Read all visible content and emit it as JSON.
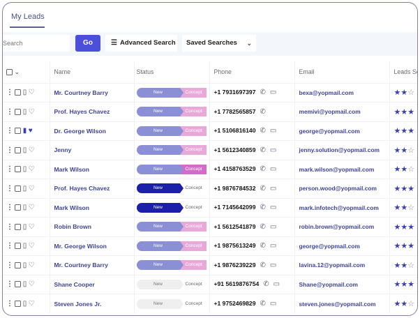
{
  "tabs": [
    {
      "label": "My Leads",
      "active": true
    }
  ],
  "toolbar": {
    "search_placeholder": "Search",
    "go_label": "Go",
    "advanced_label": "Advanced Search",
    "saved_label": "Saved Searches"
  },
  "columns": [
    "Name",
    "Status",
    "Phone",
    "Email",
    "Leads Sc"
  ],
  "colors": {
    "accent": "#4c4fd8",
    "status_light": "#8b8fd6",
    "status_dark": "#1c1fa8",
    "concept_pink": "#e8a8d8",
    "concept_magenta": "#d36cc6",
    "neutral": "#efefef"
  },
  "rows": [
    {
      "name": "Mr. Courtney Barry",
      "status": "New",
      "stage": "Concept",
      "style": "light",
      "concept": "pink",
      "phone": "+1 7931697397",
      "msg": true,
      "email": "bexa@yopmail.com",
      "stars": 2,
      "bookmarked": false,
      "liked": false
    },
    {
      "name": "Prof. Hayes Chavez",
      "status": "New",
      "stage": "Concept",
      "style": "light",
      "concept": "pink",
      "phone": "+1 7782565857",
      "msg": false,
      "email": "memivi@yopmail.com",
      "stars": 3,
      "bookmarked": false,
      "liked": false
    },
    {
      "name": "Dr. George Wilson",
      "status": "New",
      "stage": "Concept",
      "style": "light",
      "concept": "pink",
      "phone": "+1 5106816140",
      "msg": true,
      "email": "george@yopmail.com",
      "stars": 3,
      "bookmarked": true,
      "liked": true
    },
    {
      "name": "Jenny",
      "status": "New",
      "stage": "Concept",
      "style": "light",
      "concept": "pink",
      "phone": "+1 5612340859",
      "msg": true,
      "email": "jenny.solution@yopmail.com",
      "stars": 2,
      "bookmarked": false,
      "liked": false
    },
    {
      "name": "Mark Wilson",
      "status": "New",
      "stage": "Concept",
      "style": "light",
      "concept": "magenta",
      "phone": "+1 4158763529",
      "msg": true,
      "email": "mark.wilson@yopmail.com",
      "stars": 2,
      "bookmarked": false,
      "liked": false
    },
    {
      "name": "Prof. Hayes Chavez",
      "status": "New",
      "stage": "Concept",
      "style": "dark",
      "concept": "none",
      "phone": "+1 9876784532",
      "msg": true,
      "email": "person.wood@yopmail.com",
      "stars": 3,
      "bookmarked": false,
      "liked": false
    },
    {
      "name": "Mark Wilson",
      "status": "New",
      "stage": "Concept",
      "style": "dark",
      "concept": "none",
      "phone": "+1 7145642099",
      "msg": true,
      "email": "mark.infotech@yopmail.com",
      "stars": 2,
      "bookmarked": false,
      "liked": false
    },
    {
      "name": "Robin Brown",
      "status": "New",
      "stage": "Concept",
      "style": "light",
      "concept": "pink",
      "phone": "+1 5612541879",
      "msg": true,
      "email": "robin.brown@yopmail.com",
      "stars": 3,
      "bookmarked": false,
      "liked": false
    },
    {
      "name": "Mr. George Wilson",
      "status": "New",
      "stage": "Concept",
      "style": "light",
      "concept": "pink",
      "phone": "+1 9875613249",
      "msg": true,
      "email": "george@yopmail.com",
      "stars": 3,
      "bookmarked": false,
      "liked": false
    },
    {
      "name": "Mr. Courtney Barry",
      "status": "New",
      "stage": "Concept",
      "style": "light",
      "concept": "pink",
      "phone": "+1 9876239229",
      "msg": true,
      "email": "lavina.12@yopmail.com",
      "stars": 2,
      "bookmarked": false,
      "liked": false
    },
    {
      "name": "Shane Cooper",
      "status": "New",
      "stage": "Concept",
      "style": "gray",
      "concept": "none",
      "phone": "+91 5619876754",
      "msg": true,
      "email": "Shane@yopmail.com",
      "stars": 3,
      "bookmarked": false,
      "liked": false
    },
    {
      "name": "Steven Jones Jr.",
      "status": "New",
      "stage": "Concept",
      "style": "gray",
      "concept": "none",
      "phone": "+1 9752469829",
      "msg": true,
      "email": "steven.jones@yopmail.com",
      "stars": 2,
      "bookmarked": false,
      "liked": false
    }
  ]
}
